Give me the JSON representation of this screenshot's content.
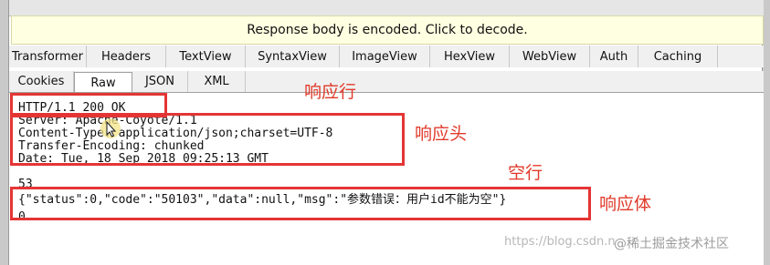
{
  "banner": {
    "text": "Response body is encoded. Click to decode."
  },
  "tabs_row1": [
    {
      "label": "Transformer",
      "w": 84
    },
    {
      "label": "Headers",
      "w": 86
    },
    {
      "label": "TextView",
      "w": 86
    },
    {
      "label": "SyntaxView",
      "w": 102
    },
    {
      "label": "ImageView",
      "w": 98
    },
    {
      "label": "HexView",
      "w": 86
    },
    {
      "label": "WebView",
      "w": 87
    },
    {
      "label": "Auth",
      "w": 52
    },
    {
      "label": "Caching",
      "w": 86
    }
  ],
  "tabs_row2": [
    {
      "label": "Cookies",
      "w": 70
    },
    {
      "label": "Raw",
      "w": 62,
      "active": true
    },
    {
      "label": "JSON",
      "w": 60
    },
    {
      "label": "XML",
      "w": 62
    }
  ],
  "response": {
    "status_line": "HTTP/1.1 200 OK",
    "headers": [
      "Server: Apache-Coyote/1.1",
      "Content-Type: application/json;charset=UTF-8",
      "Transfer-Encoding: chunked",
      "Date: Tue, 18 Sep 2018 09:25:13 GMT"
    ],
    "chunk_size": "53",
    "body": "{\"status\":0,\"code\":\"50103\",\"data\":null,\"msg\":\"参数错误：用户id不能为空\"}",
    "terminator": "0"
  },
  "annotations": {
    "status_line": "响应行",
    "headers": "响应头",
    "blank_line": "空行",
    "body": "响应体"
  },
  "watermark": {
    "url": "https://blog.csdn.n",
    "author": "@稀土掘金技术社区"
  },
  "colors": {
    "annotation_red": "#e43535",
    "banner_bg": "#ffffe1"
  }
}
